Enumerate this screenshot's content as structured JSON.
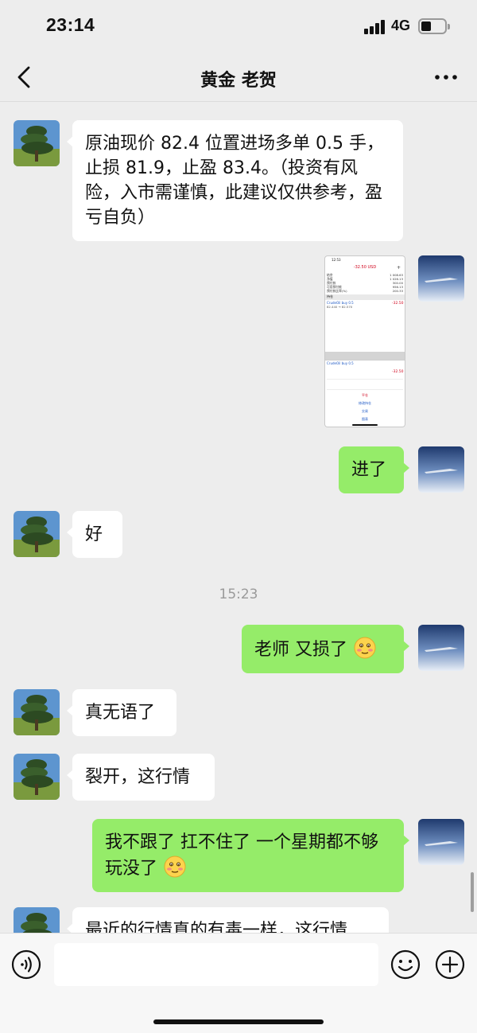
{
  "status_bar": {
    "time": "23:14",
    "network": "4G",
    "battery_level": 0.3
  },
  "nav": {
    "title": "黄金 老贺",
    "back_icon": "chevron-left-icon",
    "more_icon": "more-dots-icon"
  },
  "messages": [
    {
      "side": "in",
      "text": "原油现价 82.4 位置进场多单 0.5 手，止损 81.9，止盈 83.4。（投资有风险，入市需谨慎，此建议仅供参考，盈亏自负）"
    },
    {
      "side": "out",
      "type": "image",
      "image": {
        "time": "12:53",
        "header": "-32.50 USD",
        "rows": [
          [
            "结余",
            "1 008.63"
          ],
          [
            "净值",
            "1 026.13"
          ],
          [
            "预付款",
            "300.00"
          ],
          [
            "可用预付款",
            "956.13"
          ],
          [
            "预付款比率(%)",
            "200.33"
          ]
        ],
        "section": "持仓",
        "position_name": "CrudeOil buy 0.5",
        "position_sub": "82.440 → 82.570",
        "position_pl": "-32.50",
        "detail_name": "CrudeOil buy 0.5",
        "detail_pl": "-32.50",
        "actions": [
          "平仓",
          "修改持仓",
          "交易",
          "图表"
        ]
      }
    },
    {
      "side": "out",
      "text": "进了"
    },
    {
      "side": "in",
      "text": "好"
    },
    {
      "type": "timestamp",
      "text": "15:23"
    },
    {
      "side": "out",
      "text": "老师 又损了"
    },
    {
      "side": "in",
      "text": "真无语了"
    },
    {
      "side": "in",
      "text": "裂开，这行情"
    },
    {
      "side": "out",
      "text": "我不跟了 扛不住了  一个星期都不够玩没了"
    },
    {
      "side": "in",
      "text": "最近的行情真的有毒一样，这行情"
    }
  ],
  "inputbar": {
    "voice_icon": "voice-icon",
    "emoji_icon": "emoji-icon",
    "plus_icon": "plus-icon"
  }
}
